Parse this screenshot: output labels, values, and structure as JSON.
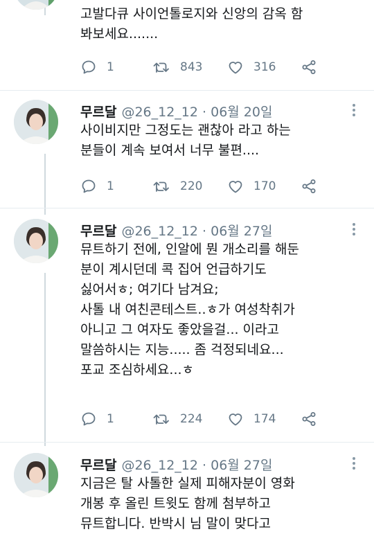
{
  "colors": {
    "text": "#14171a",
    "muted": "#657786",
    "divider": "#e6ecf0",
    "thread": "#cfd9de"
  },
  "tweets": [
    {
      "lines": [
        "고발다큐 사이언톨로지와 신앙의 감옥 함",
        "봐보세요......."
      ],
      "reply_count": "1",
      "retweet_count": "843",
      "like_count": "316"
    },
    {
      "name": "무르달",
      "meta": "@26_12_12 · 06월 20일",
      "lines": [
        "사이비지만 그정도는 괜찮아 라고 하는",
        "분들이 계속 보여서 너무 불편...."
      ],
      "reply_count": "1",
      "retweet_count": "220",
      "like_count": "170"
    },
    {
      "name": "무르달",
      "meta": "@26_12_12 · 06월 27일",
      "lines": [
        "뮤트하기 전에, 인알에 뭔 개소리를 해둔",
        "분이 계시던데 콕 집어 언급하기도",
        "싫어서ㅎ; 여기다 남겨요;",
        "사톨 내 여친콘테스트..ㅎ가 여성착취가",
        "아니고 그 여자도 좋았을걸... 이라고",
        "말씀하시는 지능..... 좀 걱정되네요...",
        "포교 조심하세요...ㅎ"
      ],
      "reply_count": "1",
      "retweet_count": "224",
      "like_count": "174"
    },
    {
      "name": "무르달",
      "meta": "@26_12_12 · 06월 27일",
      "lines": [
        "지금은 탈 사톨한 실제 피해자분이 영화",
        "개봉 후 올린 트윗도 함께 첨부하고",
        "뮤트합니다. 반박시 님 말이 맞다고"
      ]
    }
  ]
}
